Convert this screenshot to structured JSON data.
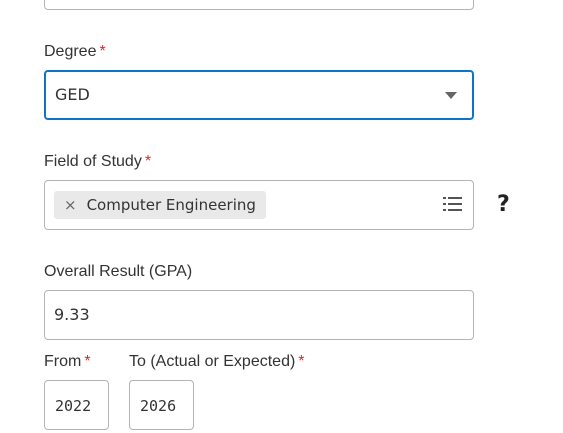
{
  "degree": {
    "label": "Degree",
    "required_mark": "*",
    "value": "GED",
    "dropdown_icon": "caret-down-icon"
  },
  "field_of_study": {
    "label": "Field of Study",
    "required_mark": "*",
    "chips": [
      {
        "remove": "×",
        "text": "Computer Engineering"
      }
    ],
    "list_icon": "list-icon",
    "help_icon": "?"
  },
  "gpa": {
    "label": "Overall Result (GPA)",
    "value": "9.33"
  },
  "dates": {
    "from_label": "From",
    "from_required": "*",
    "from_value": "2022",
    "to_label": "To (Actual or Expected)",
    "to_required": "*",
    "to_value": "2026"
  },
  "colors": {
    "required": "#de2626",
    "focus_border": "#0f73c7",
    "border": "#b4b4b4",
    "chip_bg": "#e9e9e9"
  }
}
